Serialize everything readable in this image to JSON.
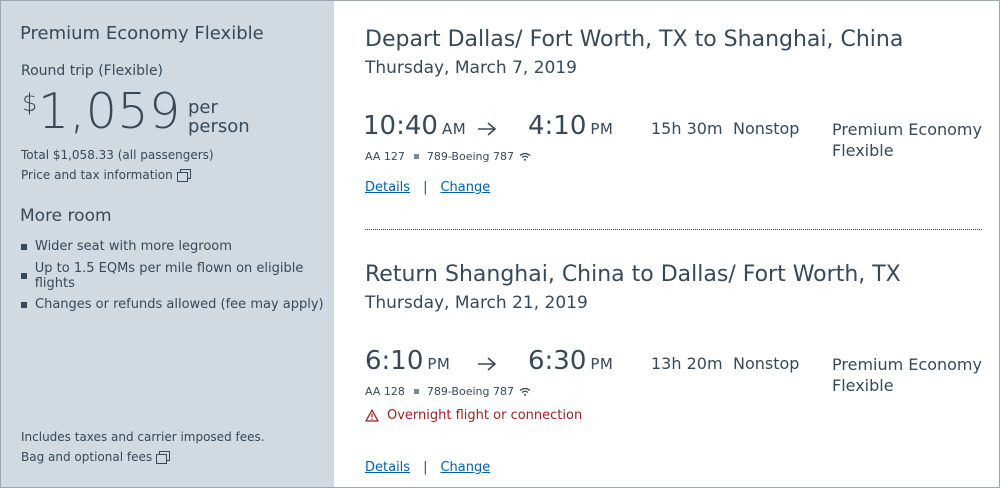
{
  "summary": {
    "fare_name": "Premium Economy Flexible",
    "trip_type": "Round trip (Flexible)",
    "currency_symbol": "$",
    "price": "1,059",
    "per_label_1": "per",
    "per_label_2": "person",
    "total": "Total $1,058.33 (all passengers)",
    "price_tax_link": "Price and tax information",
    "more_room_title": "More room",
    "benefits": [
      "Wider seat with more legroom",
      "Up to 1.5 EQMs per mile flown on eligible flights",
      "Changes or refunds allowed (fee may apply)"
    ],
    "fees_note": "Includes taxes and carrier imposed fees.",
    "bag_fees_link": "Bag and optional fees"
  },
  "slices": [
    {
      "title": "Depart Dallas/ Fort Worth, TX to Shanghai, China",
      "date": "Thursday, March 7, 2019",
      "depart_time": "10:40",
      "depart_ampm": "AM",
      "arrive_time": "4:10",
      "arrive_ampm": "PM",
      "duration": "15h 30m",
      "stops": "Nonstop",
      "cabin_line1": "Premium Economy",
      "cabin_line2": "Flexible",
      "flight_number": "AA 127",
      "aircraft": "789-Boeing 787",
      "details_link": "Details",
      "separator": "|",
      "change_link": "Change"
    },
    {
      "title": "Return Shanghai, China to Dallas/ Fort Worth, TX",
      "date": "Thursday, March 21, 2019",
      "depart_time": "6:10",
      "depart_ampm": "PM",
      "arrive_time": "6:30",
      "arrive_ampm": "PM",
      "duration": "13h 20m",
      "stops": "Nonstop",
      "cabin_line1": "Premium Economy",
      "cabin_line2": "Flexible",
      "flight_number": "AA 128",
      "aircraft": "789-Boeing 787",
      "warning": "Overnight flight or connection",
      "details_link": "Details",
      "separator": "|",
      "change_link": "Change"
    }
  ],
  "colors": {
    "left_panel_bg": "#d0dae0",
    "text": "#36495a",
    "link": "#0061ab",
    "warning": "#9e1f1f"
  },
  "icons": {
    "popup": "external-window-icon",
    "arrow": "right-arrow-icon",
    "wifi": "wifi-icon",
    "warning": "warning-triangle-icon"
  }
}
